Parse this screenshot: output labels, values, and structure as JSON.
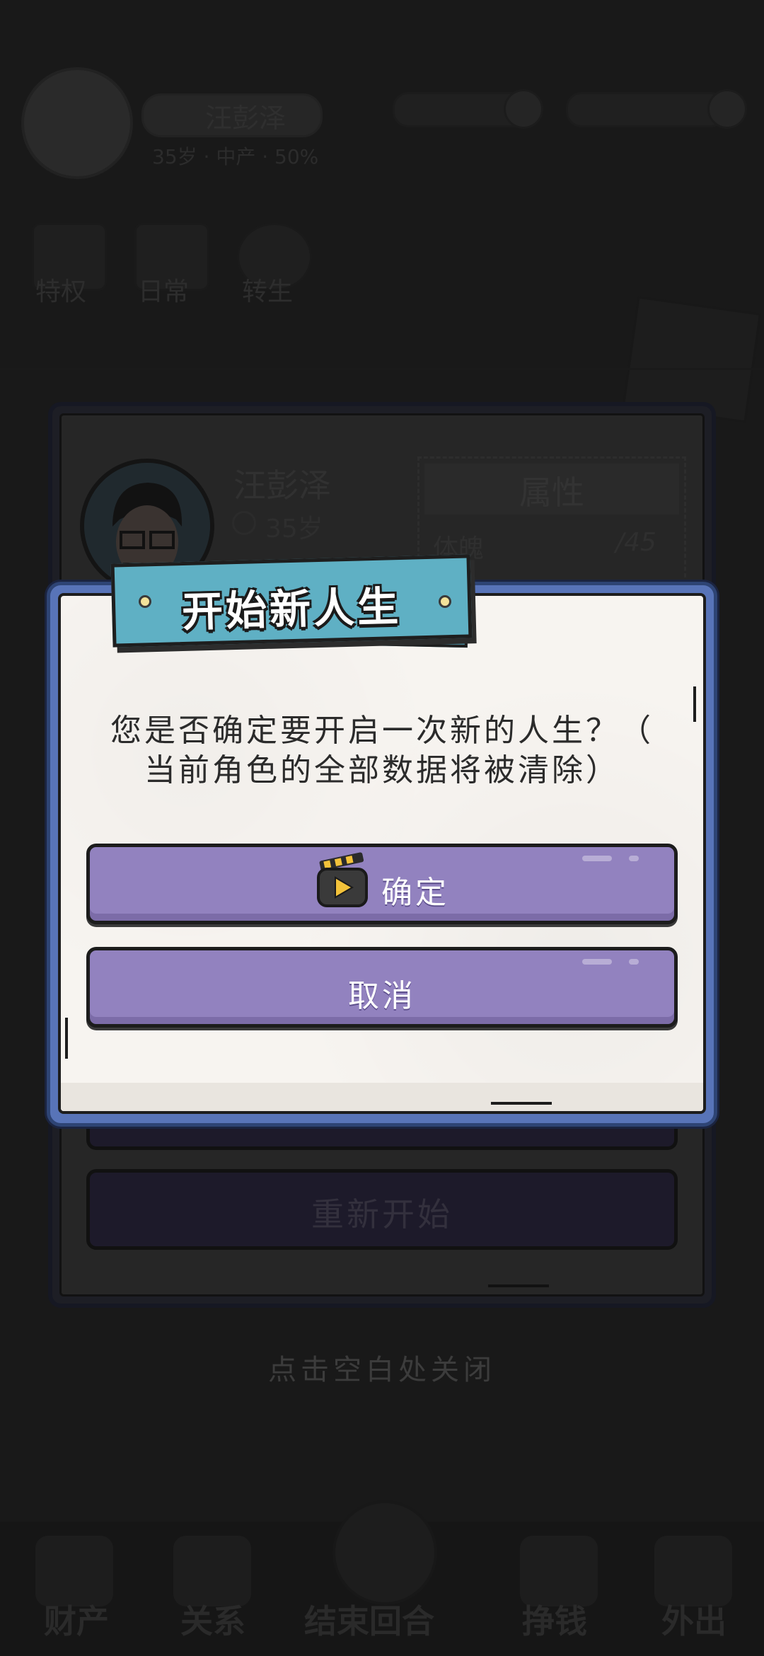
{
  "background": {
    "header": {
      "player_name": "汪彭泽",
      "stats": "35岁 · 中产 · 50%",
      "quick_actions": [
        "特权",
        "日常",
        "转生"
      ]
    },
    "character_panel": {
      "name": "汪彭泽",
      "age": "35岁",
      "attributes_title": "属性",
      "attribute_label": "体魄",
      "attribute_value": "/45",
      "restart_button": "重新开始"
    },
    "close_hint": "点击空白处关闭",
    "bottom_nav": [
      "财产",
      "关系",
      "结束回合",
      "挣钱",
      "外出"
    ]
  },
  "dialog": {
    "title": "开始新人生",
    "message_line1": "您是否确定要开启一次新的人生？（",
    "message_line2": "当前角色的全部数据将被清除）",
    "confirm_label": "确定",
    "cancel_label": "取消",
    "confirm_icon": "video-ad-icon"
  },
  "colors": {
    "button": "#9282bf",
    "title_ribbon": "#5fb0c4",
    "dialog_frame": "#5874b8",
    "paper": "#f7f4f0"
  }
}
